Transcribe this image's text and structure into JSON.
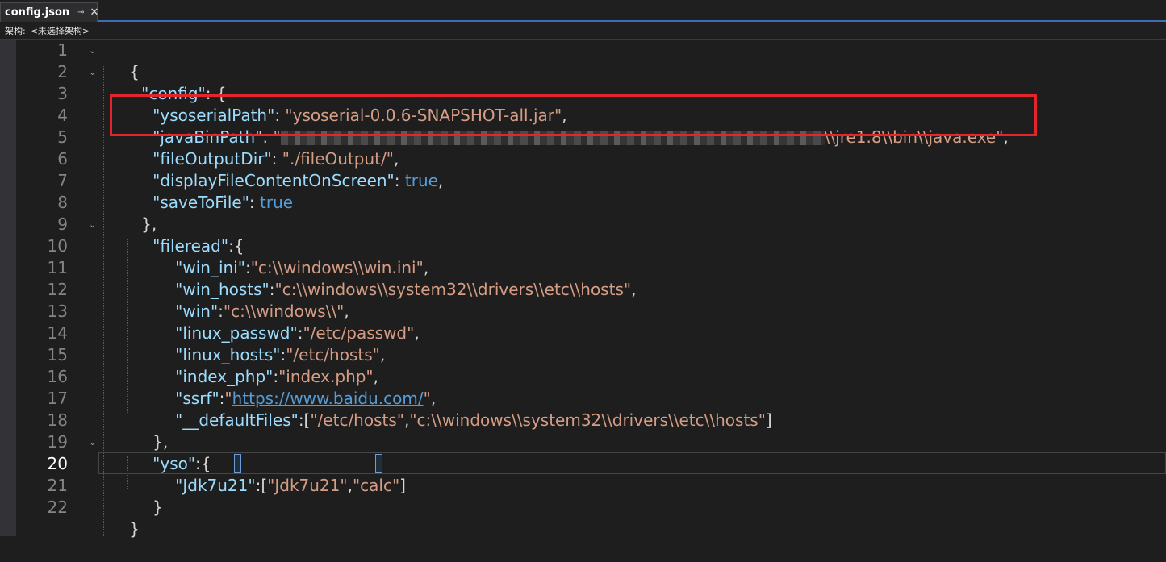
{
  "tab": {
    "title": "config.json",
    "pin_glyph": "⊸",
    "close_glyph": "✕"
  },
  "nav": {
    "arch_label": "架构:",
    "arch_value": "<未选择架构>"
  },
  "editor": {
    "current_line": 20,
    "line_numbers": [
      "1",
      "2",
      "3",
      "4",
      "5",
      "6",
      "7",
      "8",
      "9",
      "10",
      "11",
      "12",
      "13",
      "14",
      "15",
      "16",
      "17",
      "18",
      "19",
      "20",
      "21",
      "22"
    ],
    "lines": {
      "l1": {
        "open": "{"
      },
      "l2": {
        "key": "\"config\"",
        "rest": ": {"
      },
      "l3": {
        "key": "\"ysoserialPath\"",
        "colon": ": ",
        "val": "\"ysoserial-0.0.6-SNAPSHOT-all.jar\"",
        "end": ","
      },
      "l4": {
        "key": "\"javaBinPath\"",
        "colon": ": ",
        "val_start": "\"",
        "val_tail": "\\\\jre1.8\\\\bin\\\\java.exe\"",
        "end": ","
      },
      "l5": {
        "key": "\"fileOutputDir\"",
        "colon": ": ",
        "val": "\"./fileOutput/\"",
        "end": ","
      },
      "l6": {
        "key": "\"displayFileContentOnScreen\"",
        "colon": ": ",
        "val": "true",
        "end": ","
      },
      "l7": {
        "key": "\"saveToFile\"",
        "colon": ": ",
        "val": "true"
      },
      "l8": {
        "close": "},"
      },
      "l9": {
        "key": "\"fileread\"",
        "rest": ":{"
      },
      "l10": {
        "key": "\"win_ini\"",
        "colon": ":",
        "val": "\"c:\\\\windows\\\\win.ini\"",
        "end": ","
      },
      "l11": {
        "key": "\"win_hosts\"",
        "colon": ":",
        "val": "\"c:\\\\windows\\\\system32\\\\drivers\\\\etc\\\\hosts\"",
        "end": ","
      },
      "l12": {
        "key": "\"win\"",
        "colon": ":",
        "val": "\"c:\\\\windows\\\\\"",
        "end": ","
      },
      "l13": {
        "key": "\"linux_passwd\"",
        "colon": ":",
        "val": "\"/etc/passwd\"",
        "end": ","
      },
      "l14": {
        "key": "\"linux_hosts\"",
        "colon": ":",
        "val": "\"/etc/hosts\"",
        "end": ","
      },
      "l15": {
        "key": "\"index_php\"",
        "colon": ":",
        "val": "\"index.php\"",
        "end": ","
      },
      "l16": {
        "key": "\"ssrf\"",
        "colon": ":",
        "q1": "\"",
        "url": "https://www.baidu.com/",
        "q2": "\"",
        "end": ","
      },
      "l17": {
        "key": "\"__defaultFiles\"",
        "colon": ":[",
        "val1": "\"/etc/hosts\"",
        "comma": ",",
        "val2": "\"c:\\\\windows\\\\system32\\\\drivers\\\\etc\\\\hosts\"",
        "end": "]"
      },
      "l18": {
        "close": "},"
      },
      "l19": {
        "key": "\"yso\"",
        "rest": ":{"
      },
      "l20": {
        "key": "\"Jdk7u21\"",
        "colon": ":",
        "open": "[",
        "val1": "\"Jdk7u21\"",
        "comma": ",",
        "val2": "\"calc\"",
        "end": "]"
      },
      "l21": {
        "close": "}"
      },
      "l22": {
        "close": "}"
      }
    }
  },
  "colors": {
    "key": "#9cdcfe",
    "string": "#d69d85",
    "boolean": "#569cd6",
    "annotation_box": "#e3262c"
  }
}
